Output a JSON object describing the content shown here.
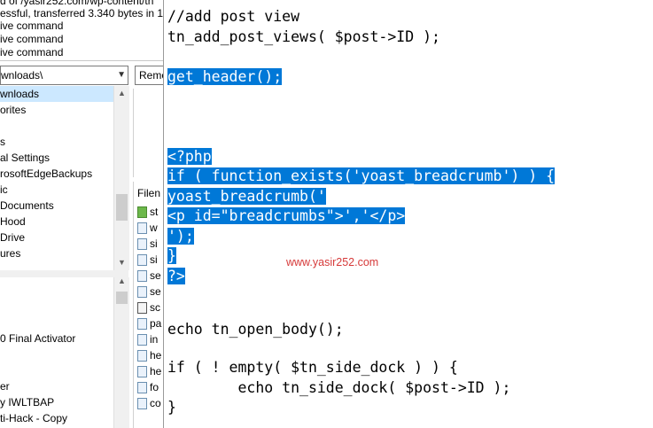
{
  "left_panel": {
    "log": [
      "d of /yasir252.com/wp-content/th",
      "essful, transferred 3.340 bytes in 1 s",
      "ive command",
      "ive command",
      "ive command"
    ],
    "local_path": "wnloads\\",
    "remote_label": "Remo",
    "tree": [
      {
        "label": "wnloads",
        "selected": true
      },
      {
        "label": "orites"
      },
      {
        "label": ""
      },
      {
        "label": "s"
      },
      {
        "label": "al Settings"
      },
      {
        "label": "rosoftEdgeBackups"
      },
      {
        "label": "ic"
      },
      {
        "label": "Documents"
      },
      {
        "label": "Hood"
      },
      {
        "label": "Drive"
      },
      {
        "label": "ures"
      }
    ],
    "local_files": [
      "",
      "",
      "",
      "0 Final Activator",
      "",
      "",
      "er",
      "y IWLTBAP",
      "ti-Hack - Copy"
    ],
    "remote_header": "Filen",
    "remote_files": [
      "st",
      "w",
      "si",
      "si",
      "se",
      "se",
      "sc",
      "pa",
      "in",
      "he",
      "he",
      "fo",
      "co"
    ]
  },
  "editor": {
    "lines": [
      {
        "text": "//add post view",
        "hl": false
      },
      {
        "text": "tn_add_post_views( $post->ID );",
        "hl": false
      },
      {
        "text": "",
        "hl": false
      },
      {
        "text": "get_header();",
        "hl": true
      },
      {
        "text": "",
        "hl": false
      },
      {
        "text": "",
        "hl": false
      },
      {
        "text": "",
        "hl": false
      },
      {
        "text": "<?php",
        "hl": true
      },
      {
        "text": "if ( function_exists('yoast_breadcrumb') ) {",
        "hl": true
      },
      {
        "text": "yoast_breadcrumb('",
        "hl": true
      },
      {
        "text": "<p id=\"breadcrumbs\">','</p>",
        "hl": true
      },
      {
        "text": "');",
        "hl": true
      },
      {
        "text": "}",
        "hl": true
      },
      {
        "text": "?>",
        "hl": true
      },
      {
        "text": "",
        "hl": false
      },
      {
        "text": "",
        "hl": false
      },
      {
        "text": "echo tn_open_body();",
        "hl": false
      },
      {
        "text": "",
        "hl": false
      },
      {
        "text": "if ( ! empty( $tn_side_dock ) ) {",
        "hl": false
      },
      {
        "text": "        echo tn_side_dock( $post->ID );",
        "hl": false
      },
      {
        "text": "}",
        "hl": false
      }
    ],
    "watermark": "www.yasir252.com",
    "selection_color": "#0078d7"
  }
}
